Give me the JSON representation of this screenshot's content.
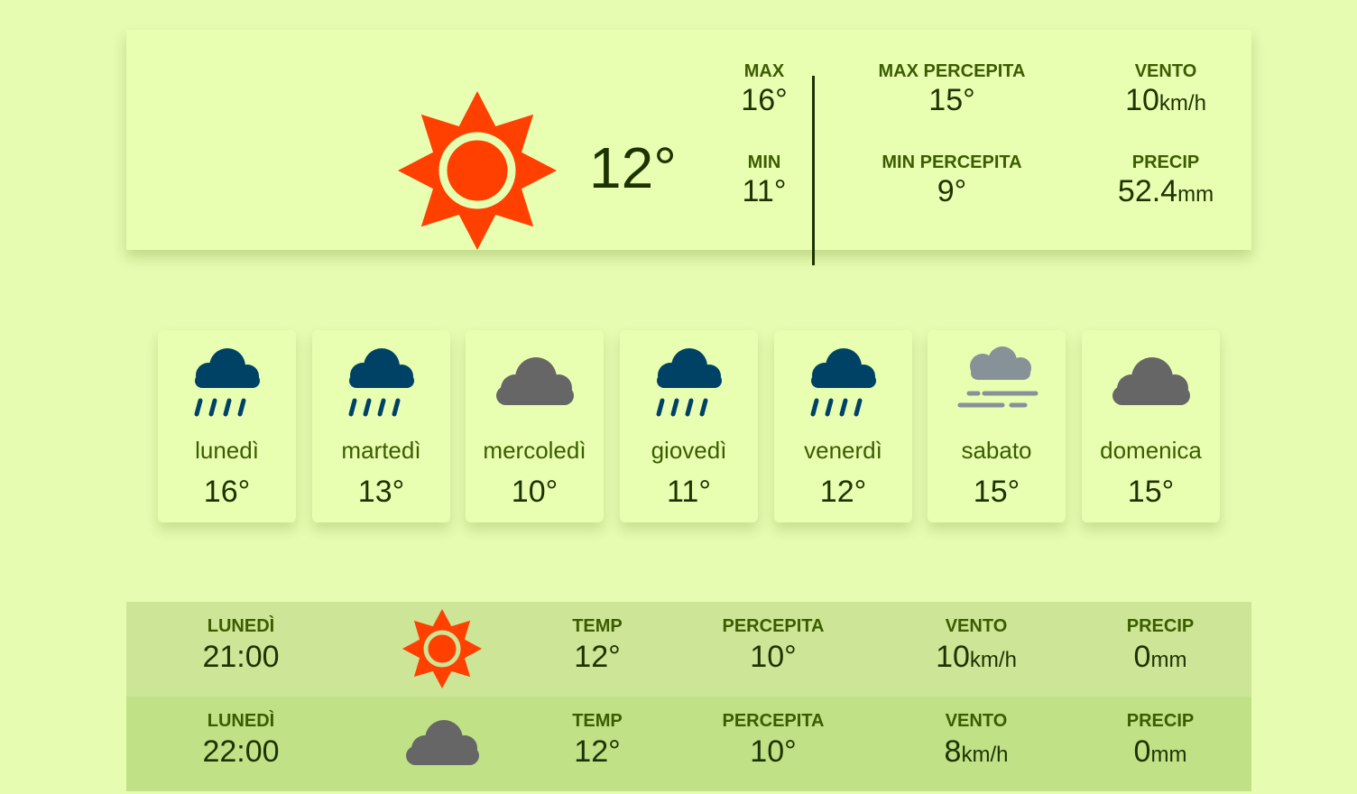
{
  "colors": {
    "background": "#e6fcb0",
    "sun": "#ff4000",
    "rain_cloud": "#004166",
    "cloud": "#666666",
    "fog": "#879198",
    "label": "#3b5c00"
  },
  "current": {
    "icon": "sun-icon",
    "temperature": "12°",
    "max_label": "MAX",
    "max_value": "16°",
    "min_label": "MIN",
    "min_value": "11°",
    "max_feels_label": "MAX PERCEPITA",
    "max_feels_value": "15°",
    "min_feels_label": "MIN PERCEPITA",
    "min_feels_value": "9°",
    "wind_label": "VENTO",
    "wind_value": "10",
    "wind_unit": "km/h",
    "precip_label": "PRECIP",
    "precip_value": "52.4",
    "precip_unit": "mm"
  },
  "days": [
    {
      "name": "lunedì",
      "temp": "16°",
      "icon": "rain-icon"
    },
    {
      "name": "martedì",
      "temp": "13°",
      "icon": "rain-icon"
    },
    {
      "name": "mercoledì",
      "temp": "10°",
      "icon": "cloud-icon"
    },
    {
      "name": "giovedì",
      "temp": "11°",
      "icon": "rain-icon"
    },
    {
      "name": "venerdì",
      "temp": "12°",
      "icon": "rain-icon"
    },
    {
      "name": "sabato",
      "temp": "15°",
      "icon": "fog-icon"
    },
    {
      "name": "domenica",
      "temp": "15°",
      "icon": "cloud-icon"
    }
  ],
  "hours": [
    {
      "day_label": "LUNEDÌ",
      "time": "21:00",
      "icon": "sun-icon",
      "temp_label": "TEMP",
      "temp": "12°",
      "feels_label": "PERCEPITA",
      "feels": "10°",
      "wind_label": "VENTO",
      "wind": "10",
      "wind_unit": "km/h",
      "precip_label": "PRECIP",
      "precip": "0",
      "precip_unit": "mm"
    },
    {
      "day_label": "LUNEDÌ",
      "time": "22:00",
      "icon": "cloud-icon",
      "temp_label": "TEMP",
      "temp": "12°",
      "feels_label": "PERCEPITA",
      "feels": "10°",
      "wind_label": "VENTO",
      "wind": "8",
      "wind_unit": "km/h",
      "precip_label": "PRECIP",
      "precip": "0",
      "precip_unit": "mm"
    }
  ]
}
